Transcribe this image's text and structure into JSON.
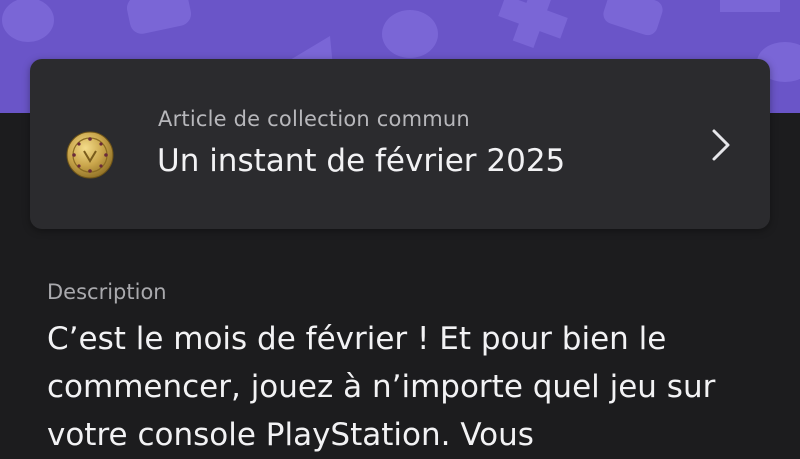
{
  "header": {
    "background_color": "#6a55c8",
    "decoration": "playstation-shapes-pattern"
  },
  "collectible": {
    "rarity_label": "Article de collection commun",
    "title": "Un instant de février 2025",
    "icon": "gold-medal-icon",
    "chevron_icon": "chevron-right-icon"
  },
  "description": {
    "label": "Description",
    "text": "C’est le mois de février ! Et pour bien le commencer, jouez à n’importe quel jeu sur votre console PlayStation. Vous"
  }
}
